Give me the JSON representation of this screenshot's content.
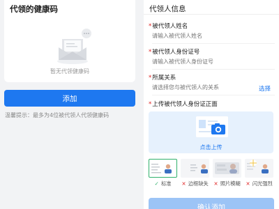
{
  "left_panel": {
    "title": "代领的健康码",
    "empty_text": "暂无代领健康码",
    "add_button": "添加",
    "tip": "温馨提示：最多为4位被代领人代领健康码"
  },
  "right_panel": {
    "title": "代领人信息",
    "fields": [
      {
        "label": "被代领人姓名",
        "placeholder": "请输入被代领人姓名"
      },
      {
        "label": "被代领人身份证号",
        "placeholder": "请输入被代领人身份证号"
      },
      {
        "label": "所属关系",
        "placeholder": "请选择您与被代领人的关系",
        "action": "选择"
      }
    ],
    "upload": {
      "label": "上传被代领人身份证正面",
      "button": "点击上传"
    },
    "samples": [
      {
        "label": "标准",
        "status": "ok"
      },
      {
        "label": "边框缺失",
        "status": "bad"
      },
      {
        "label": "照片模糊",
        "status": "bad"
      },
      {
        "label": "闪光强烈",
        "status": "bad"
      }
    ],
    "confirm_button": "确认添加"
  },
  "colors": {
    "accent": "#1e78f0",
    "required": "#e02020",
    "ok": "#2fb06b",
    "upload_bg": "#e6f1fd",
    "disabled_button": "#9cc4f6"
  }
}
